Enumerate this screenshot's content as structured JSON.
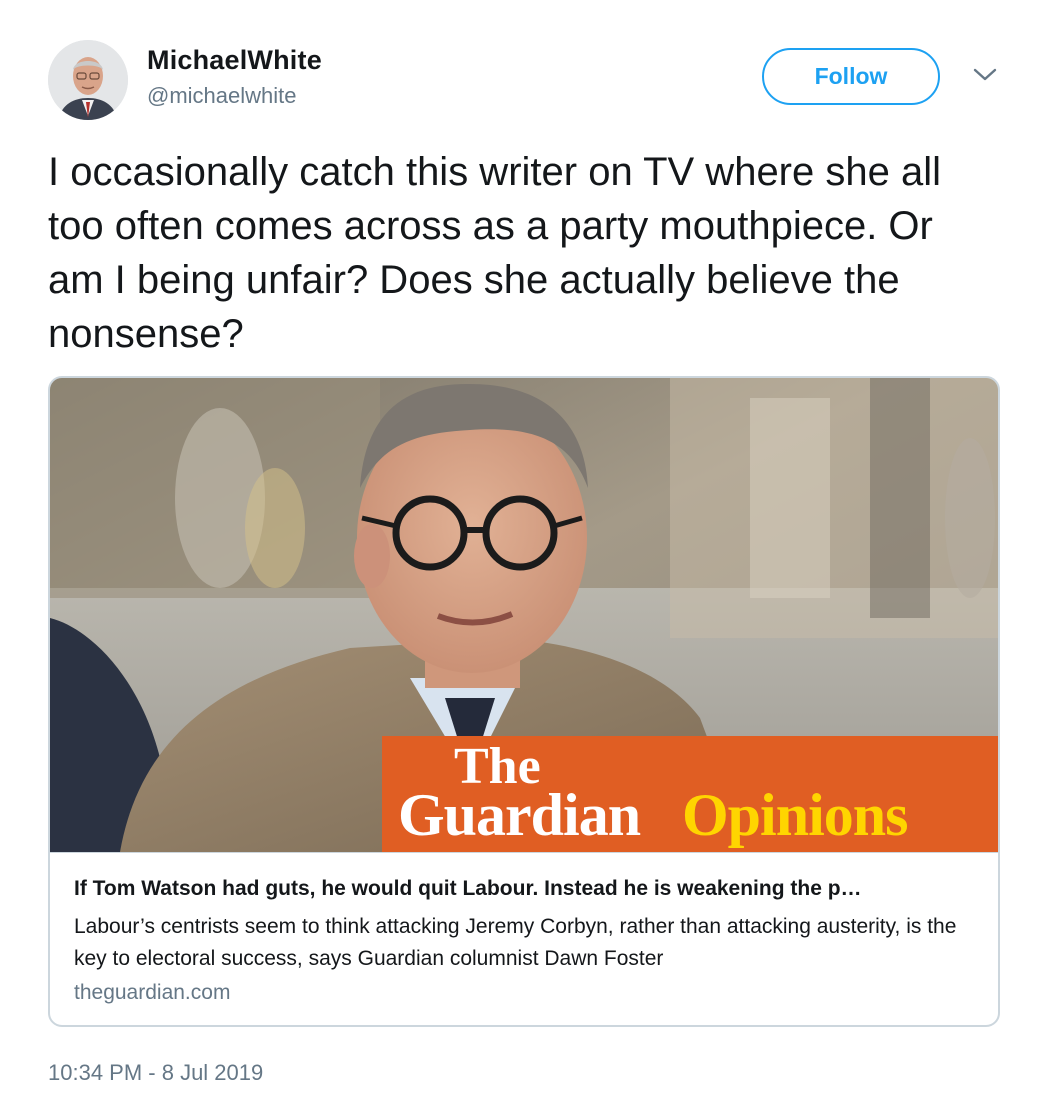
{
  "author": {
    "display_name": "MichaelWhite",
    "handle": "@michaelwhite"
  },
  "actions": {
    "follow_label": "Follow"
  },
  "tweet": {
    "text": "I occasionally catch this writer on TV where she all too often comes across as a party mouthpiece. Or am I being unfair? Does she actually believe the nonsense?",
    "timestamp": "10:34 PM - 8 Jul 2019"
  },
  "card": {
    "brand": {
      "the": "The",
      "guardian": "Guardian",
      "opinions": "Opinions"
    },
    "title": "If Tom Watson had guts, he would quit Labour. Instead he is weakening the p…",
    "description": "Labour’s centrists seem to think attacking Jeremy Corbyn, rather than attacking austerity, is the key to electoral success, says Guardian columnist Dawn Foster",
    "domain": "theguardian.com"
  },
  "colors": {
    "accent": "#1da1f2",
    "muted_text": "#657786",
    "guardian_orange": "#e05e23",
    "guardian_yellow": "#ffd500"
  }
}
